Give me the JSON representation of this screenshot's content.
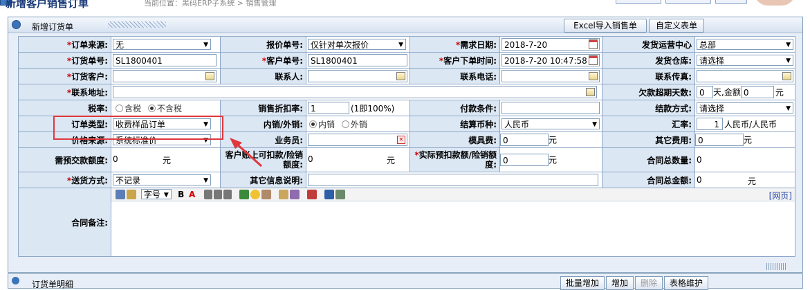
{
  "page": {
    "title": "新增订货单",
    "top_title": "新增客户销售订单",
    "breadcrumb": "当前位置：黑码ERP子系统 > 销售管理"
  },
  "header_buttons": {
    "excel_import": "Excel导入销售单",
    "custom_form": "自定义表单"
  },
  "form": {
    "row1": {
      "order_source_label": "订单来源:",
      "order_source_value": "无",
      "quote_no_label": "报价单号:",
      "quote_no_value": "仅针对单次报价",
      "demand_date_label": "需求日期:",
      "demand_date_value": "2018-7-20",
      "ship_center_label": "发货运营中心",
      "ship_center_value": "总部"
    },
    "row2": {
      "order_no_label": "订货单号:",
      "order_no_value": "SL1800401",
      "customer_no_label": "客户单号:",
      "customer_no_value": "SL1800401",
      "customer_order_time_label": "客户下单时间:",
      "customer_order_time_value": "2018-7-20 10:47:58",
      "ship_warehouse_label": "发货仓库:",
      "ship_warehouse_value": "请选择"
    },
    "row3": {
      "customer_label": "订货客户:",
      "contact_label": "联系人:",
      "phone_label": "联系电话:",
      "fax_label": "联系传真:"
    },
    "row4": {
      "address_label": "联系地址:",
      "overdue_label": "欠款超期天数:",
      "overdue_days": "0",
      "overdue_mid": "天,金额",
      "overdue_amount": "0",
      "overdue_unit": "元"
    },
    "row5": {
      "tax_label": "税率:",
      "tax_opt1": "含税",
      "tax_opt2": "不含税",
      "discount_label": "销售折扣率:",
      "discount_value": "1",
      "discount_hint": "(1即100%)",
      "payment_terms_label": "付款条件:",
      "settle_method_label": "结款方式:",
      "settle_method_value": "请选择"
    },
    "row6": {
      "order_type_label": "订单类型:",
      "order_type_value": "收费样品订单",
      "domestic_label": "内销/外销:",
      "domestic_opt1": "内销",
      "domestic_opt2": "外销",
      "currency_label": "结算币种:",
      "currency_value": "人民币",
      "exchange_label": "汇率:",
      "exchange_value": "1",
      "exchange_unit": "人民币/人民币"
    },
    "row7": {
      "price_source_label": "价格来源:",
      "price_source_value": "系统标准价",
      "salesman_label": "业务员:",
      "mold_fee_label": "模具费:",
      "mold_fee_value": "0",
      "mold_fee_unit": "元",
      "other_fee_label": "其它费用:",
      "other_fee_value": "0",
      "other_fee_unit": "元"
    },
    "row8": {
      "prepay_label": "需预交款额度:",
      "prepay_value": "0",
      "prepay_unit": "元",
      "deduct_label": "客户账上可扣款/险销额度:",
      "deduct_value": "0",
      "deduct_unit": "元",
      "actual_prepay_label": "实际预扣款额/险销额度:",
      "actual_prepay_value": "0",
      "actual_prepay_unit": "元",
      "contract_qty_label": "合同总数量:",
      "contract_qty_value": "0"
    },
    "row9": {
      "delivery_label": "送货方式:",
      "delivery_value": "不记录",
      "other_info_label": "其它信息说明:",
      "contract_amount_label": "合同总金额:",
      "contract_amount_value": "0",
      "contract_amount_unit": "元"
    },
    "row10": {
      "contract_note_label": "合同备注:",
      "font_size_select": "字号",
      "source_link": "[网页]"
    }
  },
  "bottom": {
    "title": "订货单明细",
    "btn1": "批量增加",
    "btn2": "增加",
    "btn3": "删除",
    "btn4": "表格维护"
  }
}
